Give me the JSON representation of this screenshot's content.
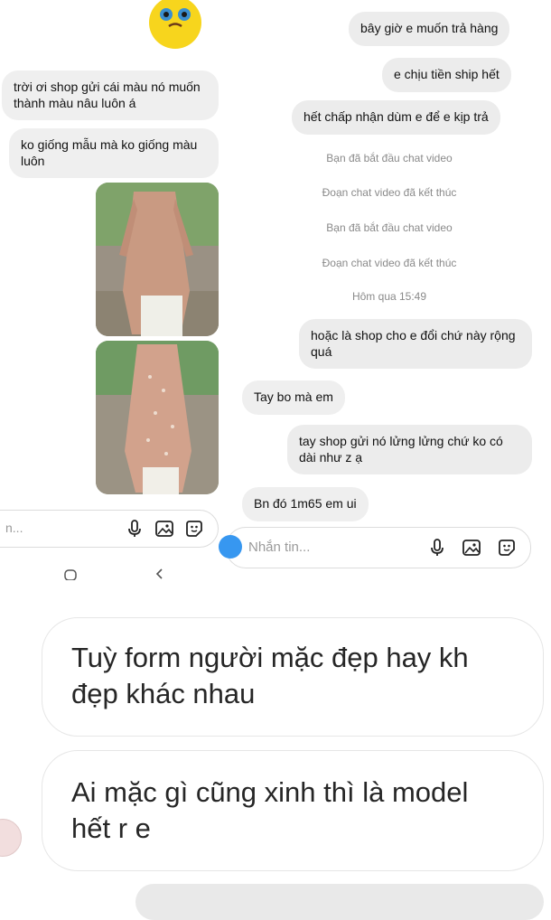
{
  "left_chat": {
    "messages": [
      "trời ơi shop gửi cái màu nó muốn thành màu nâu luôn á",
      "ko giống mẫu mà ko giống màu luôn"
    ],
    "input_placeholder": "n..."
  },
  "right_chat": {
    "messages_top": [
      "bây giờ e muốn trả hàng",
      "e chịu tiền ship hết",
      "hết chấp nhận dùm e để e kịp trả"
    ],
    "system": [
      "Bạn đã bắt đầu chat video",
      "Đoạn chat video đã kết thúc",
      "Bạn đã bắt đầu chat video",
      "Đoạn chat video đã kết thúc"
    ],
    "timestamp": "Hôm qua 15:49",
    "messages_bottom": {
      "me_1": "hoặc là shop cho e đổi chứ này rộng quá",
      "them_1": "Tay bo mà em",
      "me_2": "tay shop gửi nó lửng lửng chứ ko có dài như z ạ",
      "them_2": "Bn đó 1m65 em ui"
    },
    "input_placeholder": "Nhắn tin..."
  },
  "lower_chat": {
    "messages": [
      "Tuỳ form người mặc đẹp hay kh đẹp khác nhau",
      "Ai mặc gì cũng xinh thì là model hết r e"
    ]
  },
  "colors": {
    "bubble_bg": "#efefef",
    "avatar_yellow": "#f7d51d",
    "send_blue": "#3797f0"
  },
  "icons": [
    "microphone-icon",
    "image-icon",
    "sticker-icon",
    "home-nav-icon",
    "back-nav-icon",
    "avatar-emoji-icon"
  ]
}
